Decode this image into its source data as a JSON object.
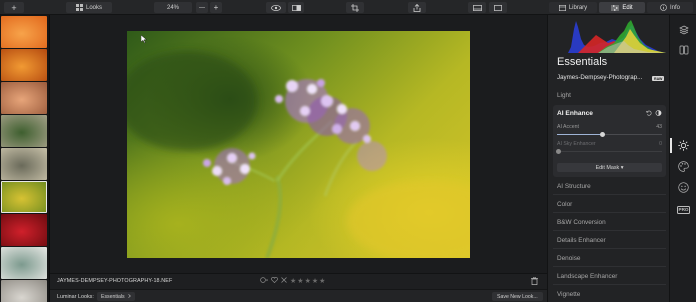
{
  "toolbar": {
    "add_label": "+",
    "looks_label": "Looks",
    "zoom_value": "24%",
    "zoom_minus": "—",
    "zoom_plus": "+",
    "library_label": "Library",
    "edit_label": "Edit",
    "info_label": "Info",
    "add_icon": "plus-icon",
    "looks_icon": "grid-icon",
    "view_icon": "eye-icon",
    "compare_icon": "split-view-icon",
    "crop_icon": "crop-icon",
    "share_icon": "share-icon",
    "filmstrip_icon": "filmstrip-icon",
    "single_view_icon": "single-view-icon"
  },
  "filmstrip": {
    "thumbnails": [
      {
        "colors": [
          "#f7a34a",
          "#e0661b"
        ]
      },
      {
        "colors": [
          "#f19a33",
          "#b4490f"
        ]
      },
      {
        "colors": [
          "#e7a57a",
          "#9a5a3b"
        ]
      },
      {
        "colors": [
          "#3e5f2f",
          "#a5a088"
        ]
      },
      {
        "colors": [
          "#6a6a5a",
          "#c7c0a8"
        ]
      },
      {
        "colors": [
          "#d7c233",
          "#6b8a1f"
        ]
      },
      {
        "colors": [
          "#d0202b",
          "#6b0b0f"
        ]
      },
      {
        "colors": [
          "#7c9a8e",
          "#e7e7e4"
        ]
      },
      {
        "colors": [
          "#d9d6d0",
          "#8f8b84"
        ]
      }
    ],
    "selected_index": 5
  },
  "image": {
    "filename": "JAYMES-DEMPSEY-PHOTOGRAPHY-18.NEF"
  },
  "bottom": {
    "looks_label": "Luminar Looks:",
    "looks_value": "Essentials",
    "save_look_label": "Save New Look...",
    "rating_stars": 5,
    "rating_value": 0
  },
  "panel": {
    "title": "Essentials",
    "preset_name": "Jaymes-Dempsey-Photograp...",
    "raw_badge": "RAW",
    "light_label": "Light",
    "ai_enhance": {
      "title": "AI Enhance",
      "accent_label": "AI Accent",
      "accent_value": "43",
      "accent_level": 0.43,
      "sky_label": "AI Sky Enhancer",
      "sky_value": "0",
      "sky_level": 0,
      "edit_mask_label": "Edit Mask ▾"
    },
    "sections": [
      "AI Structure",
      "Color",
      "B&W Conversion",
      "Details Enhancer",
      "Denoise",
      "Landscape Enhancer",
      "Vignette"
    ]
  },
  "rail": {
    "icons": [
      "layers-icon",
      "compare-panels-icon",
      "sun-icon",
      "palette-icon",
      "smiley-icon",
      "pro-icon"
    ],
    "pro_label": "PRO"
  },
  "colors": {
    "accent": "#9fb4d6",
    "background": "#1b1c1e",
    "panel": "#222325"
  }
}
